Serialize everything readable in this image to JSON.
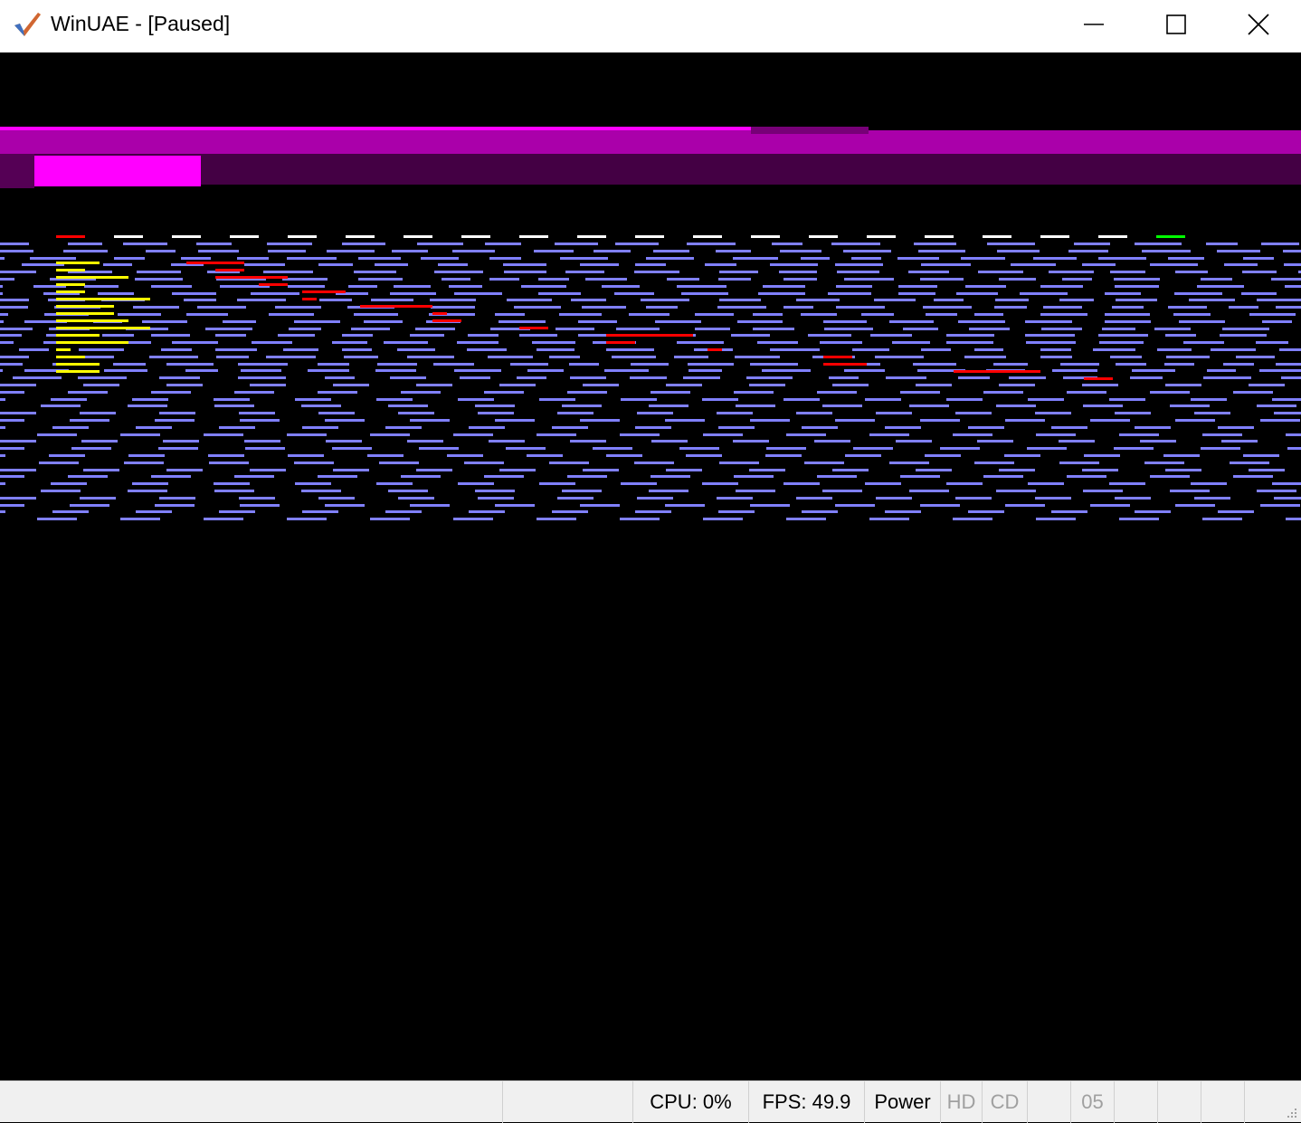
{
  "window": {
    "title": "WinUAE - [Paused]",
    "icon": "winuae-checkmark-icon",
    "controls": [
      "minimize-icon",
      "maximize-icon",
      "close-icon"
    ]
  },
  "status_bar": {
    "cpu": "CPU: 0%",
    "fps": "FPS: 49.9",
    "power": "Power",
    "hd": "HD",
    "cd": "CD",
    "drive": "05"
  },
  "colors": {
    "playfield_lines": "#8080ff",
    "magenta_bar": "#aa00aa",
    "bright_magenta": "#ff00ff",
    "dark_magenta": "#440044",
    "yellow": "#ffff00",
    "red": "#ff0000",
    "green": "#00ff00",
    "white": "#ffffff"
  }
}
